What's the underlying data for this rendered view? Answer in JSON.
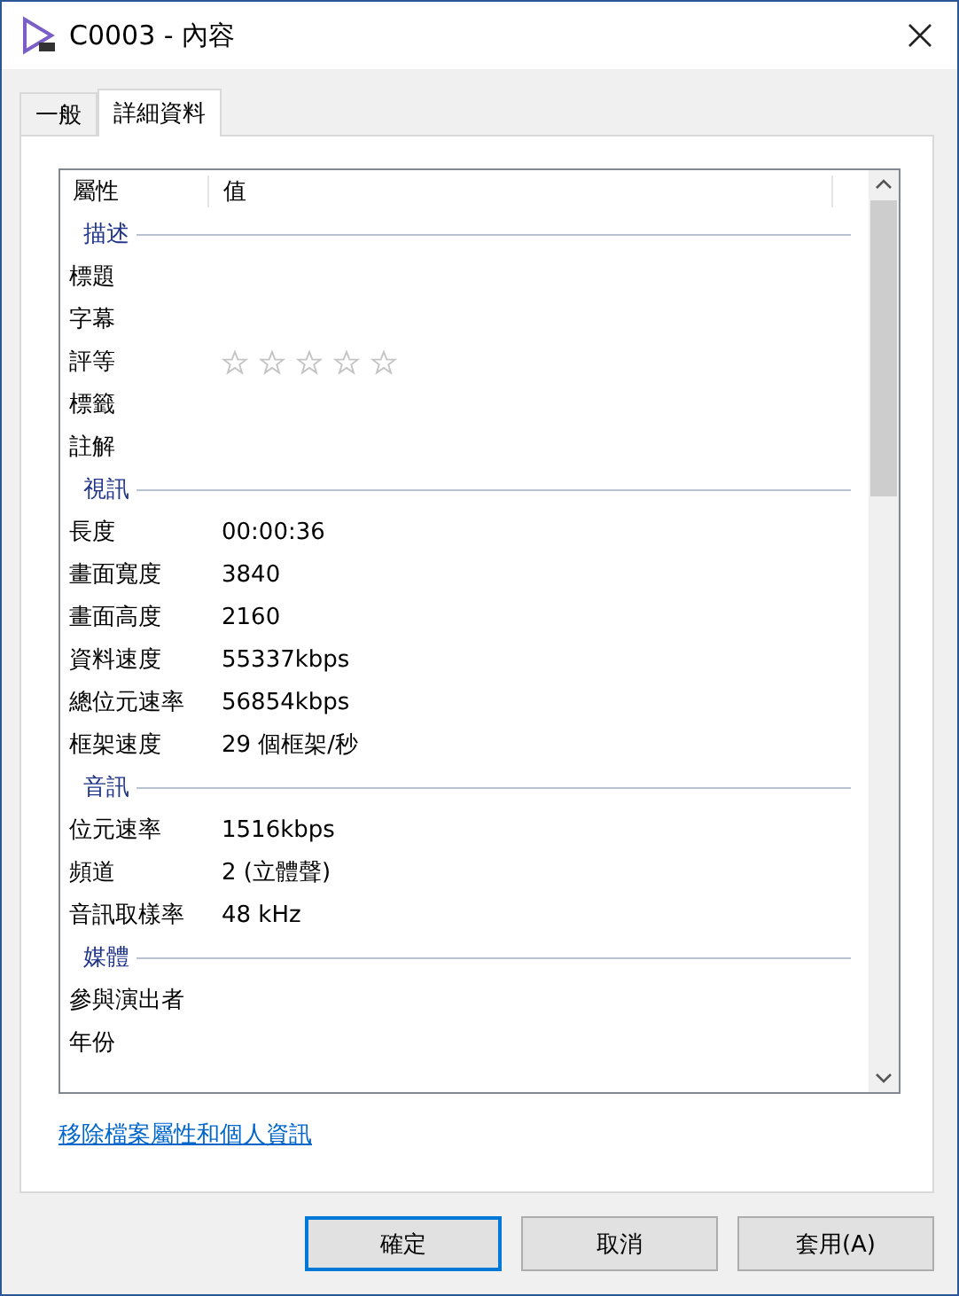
{
  "window": {
    "title": "C0003 - 內容"
  },
  "tabs": [
    {
      "label": "一般",
      "selected": false
    },
    {
      "label": "詳細資料",
      "selected": true
    }
  ],
  "table": {
    "columns": [
      "屬性",
      "值"
    ],
    "sections": [
      {
        "name": "描述",
        "rows": [
          {
            "kind": "text",
            "property": "標題"
          },
          {
            "kind": "text",
            "property": "字幕"
          },
          {
            "kind": "stars",
            "property": "評等",
            "stars": 0
          },
          {
            "kind": "text",
            "property": "標籤"
          },
          {
            "kind": "text",
            "property": "註解"
          }
        ]
      },
      {
        "name": "視訊",
        "rows": [
          {
            "kind": "text",
            "property": "長度",
            "value": "00:00:36"
          },
          {
            "kind": "text",
            "property": "畫面寬度",
            "value": "3840"
          },
          {
            "kind": "text",
            "property": "畫面高度",
            "value": "2160"
          },
          {
            "kind": "text",
            "property": "資料速度",
            "value": "55337kbps"
          },
          {
            "kind": "text",
            "property": "總位元速率",
            "value": "56854kbps"
          },
          {
            "kind": "text",
            "property": "框架速度",
            "value": "29 個框架/秒"
          }
        ]
      },
      {
        "name": "音訊",
        "rows": [
          {
            "kind": "text",
            "property": "位元速率",
            "value": "1516kbps"
          },
          {
            "kind": "text",
            "property": "頻道",
            "value": "2 (立體聲)"
          },
          {
            "kind": "text",
            "property": "音訊取樣率",
            "value": "48 kHz"
          }
        ]
      },
      {
        "name": "媒體",
        "rows": [
          {
            "kind": "text",
            "property": "參與演出者"
          },
          {
            "kind": "text",
            "property": "年份"
          }
        ]
      }
    ]
  },
  "link": "移除檔案屬性和個人資訊",
  "buttons": [
    "確定",
    "取消",
    "套用(A)"
  ]
}
